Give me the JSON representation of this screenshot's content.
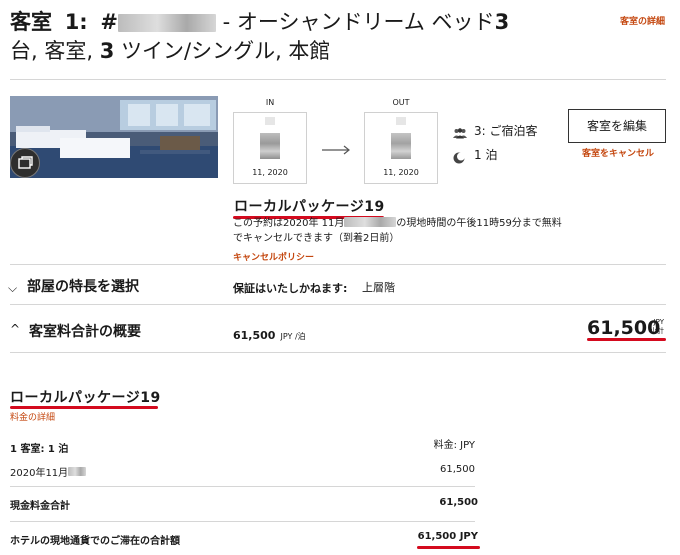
{
  "header": {
    "title_prefix": "客室",
    "room_no_label": "1:",
    "hash": "#",
    "title_rest_1": " - オーシャンドリーム ベッド",
    "title_num_1": "3",
    "title_line2_a": "台, 客室, ",
    "title_num_2": "3",
    "title_line2_b": " ツイン/シングル, 本館",
    "room_details_link": "客室の詳細"
  },
  "stay": {
    "in_label": "IN",
    "out_label": "OUT",
    "in_date": "11, 2020",
    "out_date": "11, 2020",
    "guests": "3: ご宿泊客",
    "nights": "1 泊",
    "guests_icon": "people-icon",
    "nights_icon": "moon-icon",
    "arrow_icon": "arrow-right-icon"
  },
  "actions": {
    "edit_button": "客室を編集",
    "cancel_link": "客室をキャンセル"
  },
  "package": {
    "name": "ローカルパッケージ19",
    "policy_line1_a": "この予約は2020年 11月",
    "policy_line1_b": "の現地時間の午後11時59分まで無料",
    "policy_line2": "でキャンセルできます（到着2日前）",
    "policy_link": "キャンセルポリシー"
  },
  "features": {
    "title": "部屋の特長を選択",
    "not_guaranteed_label": "保証はいたしかねます:",
    "not_guaranteed_value": "上層階"
  },
  "rate_summary": {
    "title": "客室料合計の概要",
    "per_night": "61,500",
    "per_night_unit": "JPY /泊",
    "total": "61,500",
    "currency": "JPY",
    "subtotal_label": "小計"
  },
  "breakdown": {
    "package_name": "ローカルパッケージ19",
    "rate_details_link": "料金の詳細",
    "room_nights": "1 客室: 1 泊",
    "rate_currency": "料金: JPY",
    "date_label": "2020年11月",
    "date_amount": "61,500",
    "cash_total_label": "現金料金合計",
    "cash_total": "61,500",
    "local_total_label": "ホテルの現地通貨でのご滞在の合計額",
    "local_total": "61,500 JPY"
  },
  "colors": {
    "accent_orange": "#c4470f",
    "underline_red": "#d40a1e"
  }
}
